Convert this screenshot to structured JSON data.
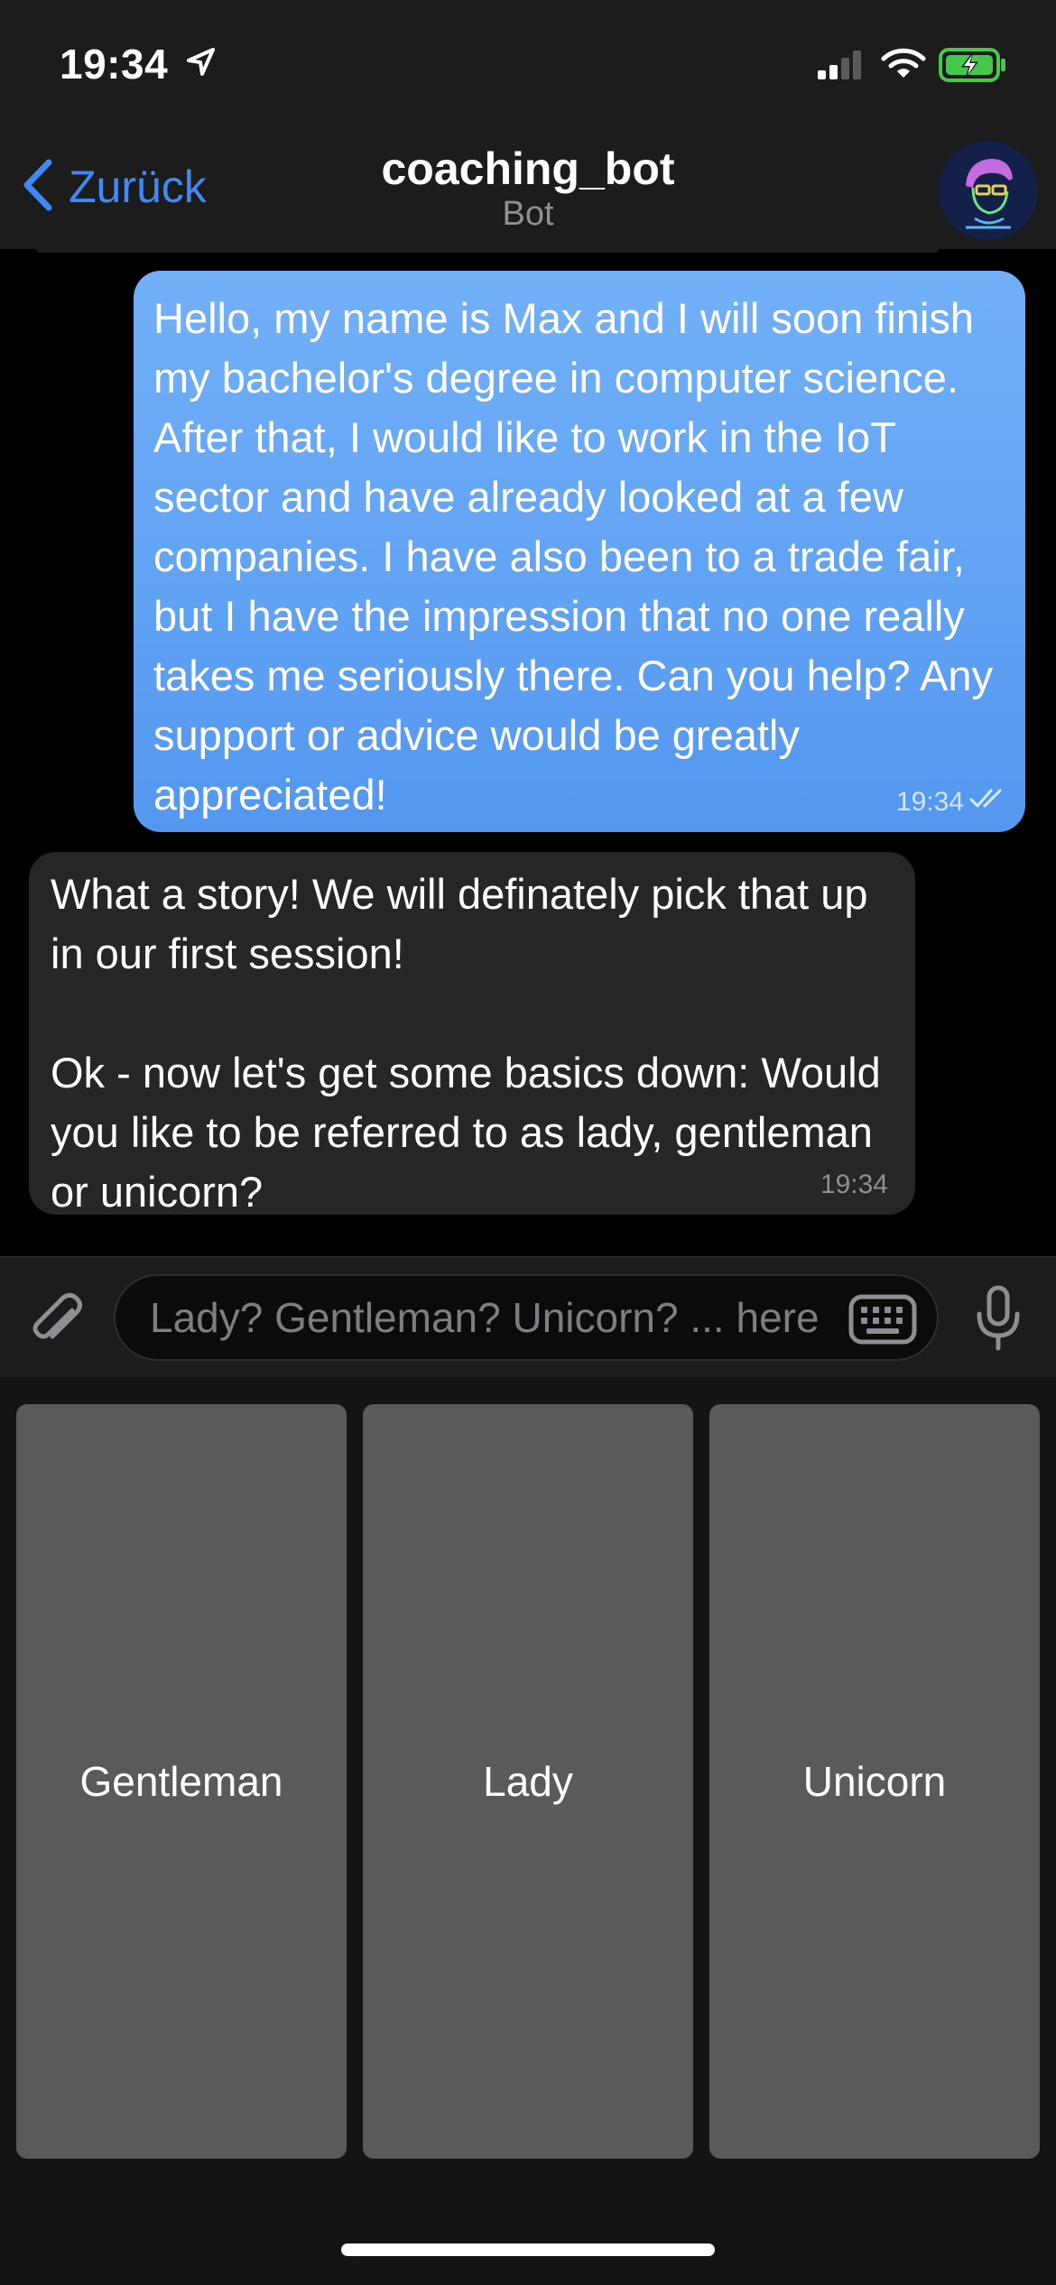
{
  "status_bar": {
    "time": "19:34",
    "icons": [
      "location-arrow-icon",
      "signal-icon",
      "wifi-icon",
      "battery-charging-icon"
    ]
  },
  "nav": {
    "back_label": "Zurück",
    "title": "coaching_bot",
    "subtitle": "Bot"
  },
  "colors": {
    "accent": "#3e88f7",
    "outgoing_bubble": "#5fa3f5",
    "incoming_bubble": "#262628",
    "reply_button": "#5a5a5c"
  },
  "messages": [
    {
      "direction": "outgoing",
      "text": "Hello, my name is Max and I will soon finish my bachelor's degree in computer science. After that, I would like to work in the IoT sector and have already looked at a few companies. I have also been to a trade fair, but I have the impression that no one really takes me seriously there. Can you help? Any support or advice would be greatly appreciated!",
      "time": "19:34",
      "status_icon": "double-check-icon"
    },
    {
      "direction": "incoming",
      "text": "What a story! We will definately pick that up in our first session!\n\nOk - now let's get some basics down: Would you like to be referred to as lady, gentleman or unicorn?",
      "time": "19:34"
    }
  ],
  "input": {
    "placeholder": "Lady? Gentleman? Unicorn? ... here you...",
    "value": ""
  },
  "reply_keyboard": {
    "buttons": [
      "Gentleman",
      "Lady",
      "Unicorn"
    ]
  }
}
